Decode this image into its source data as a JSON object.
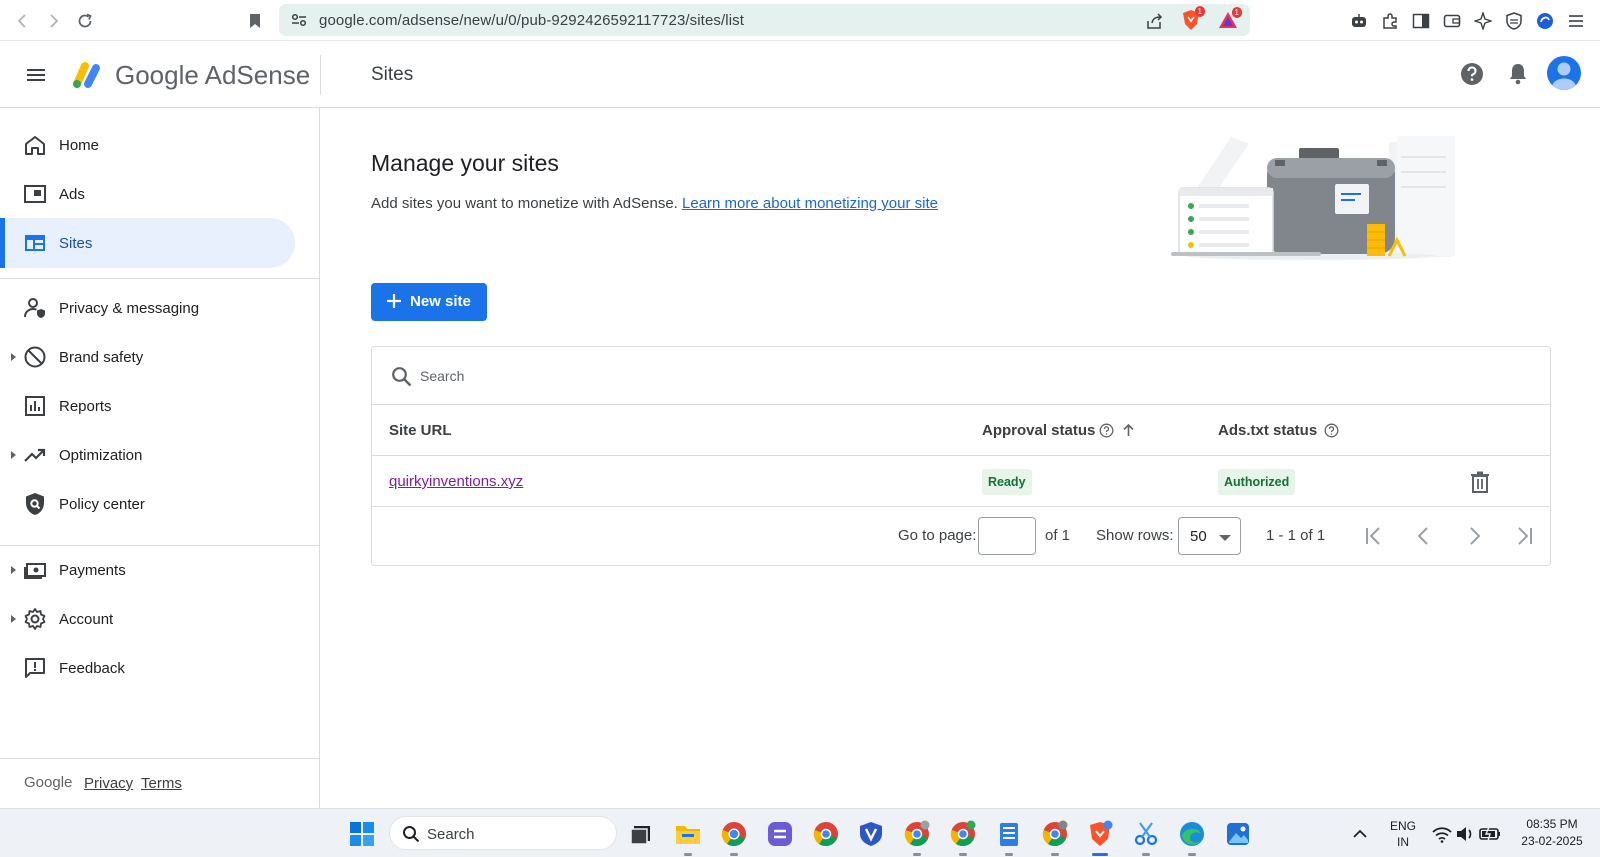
{
  "browser": {
    "url": "google.com/adsense/new/u/0/pub-9292426592117723/sites/list",
    "ext_badge_1": "1",
    "ext_badge_2": "1"
  },
  "header": {
    "brand": "Google AdSense",
    "page_title": "Sites"
  },
  "sidebar": {
    "items": [
      {
        "label": "Home",
        "icon": "home-icon"
      },
      {
        "label": "Ads",
        "icon": "ads-icon"
      },
      {
        "label": "Sites",
        "icon": "sites-icon",
        "active": true
      },
      {
        "label": "Privacy & messaging",
        "icon": "privacy-icon"
      },
      {
        "label": "Brand safety",
        "icon": "block-icon"
      },
      {
        "label": "Reports",
        "icon": "bar-chart-icon"
      },
      {
        "label": "Optimization",
        "icon": "trending-icon"
      },
      {
        "label": "Policy center",
        "icon": "policy-icon"
      },
      {
        "label": "Payments",
        "icon": "payments-icon"
      },
      {
        "label": "Account",
        "icon": "gear-icon"
      },
      {
        "label": "Feedback",
        "icon": "feedback-icon"
      }
    ],
    "footer": {
      "google": "Google",
      "privacy": "Privacy",
      "terms": "Terms"
    }
  },
  "main": {
    "title": "Manage your sites",
    "description": "Add sites you want to monetize with AdSense.",
    "learn_more": "Learn more about monetizing your site",
    "new_site_label": "New site",
    "search_placeholder": "Search",
    "columns": {
      "site_url": "Site URL",
      "approval_status": "Approval status",
      "ads_txt_status": "Ads.txt status"
    },
    "rows": [
      {
        "site": "quirkyinventions.xyz",
        "approval": "Ready",
        "ads_txt": "Authorized"
      }
    ],
    "pager": {
      "go_to_page": "Go to page:",
      "of_pages": "of 1",
      "show_rows": "Show rows:",
      "rows_value": "50",
      "range": "1 - 1 of 1"
    }
  },
  "taskbar": {
    "search": "Search",
    "lang_1": "ENG",
    "lang_2": "IN",
    "time": "08:35 PM",
    "date": "23-02-2025"
  },
  "colors": {
    "accent": "#1a73e8",
    "active_bg": "#e8f0fe",
    "chip_bg": "#e6f4ea",
    "chip_text": "#137333",
    "visited_link": "#7b1fa2"
  }
}
